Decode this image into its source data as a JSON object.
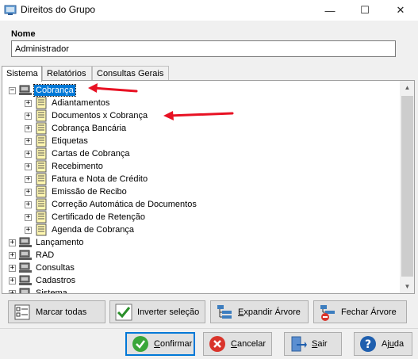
{
  "window": {
    "title": "Direitos do Grupo",
    "controls": {
      "minimize": "—",
      "maximize": "☐",
      "close": "✕"
    }
  },
  "nome": {
    "label": "Nome",
    "value": "Administrador"
  },
  "tabs": [
    {
      "label": "Sistema",
      "active": true
    },
    {
      "label": "Relatórios",
      "active": false
    },
    {
      "label": "Consultas Gerais",
      "active": false
    }
  ],
  "tree": {
    "root_selected": "Cobrança",
    "children_of_cobranca": [
      "Adiantamentos",
      "Documentos x Cobrança",
      "Cobrança Bancária",
      "Etiquetas",
      "Cartas de Cobrança",
      "Recebimento",
      "Fatura e Nota de Crédito",
      "Emissão de Recibo",
      "Correção Automática de Documentos",
      "Certificado de Retenção",
      "Agenda de Cobrança"
    ],
    "other_roots": [
      "Lançamento",
      "RAD",
      "Consultas",
      "Cadastros",
      "Sistema"
    ],
    "expander_collapsed": "+",
    "expander_expanded": "−"
  },
  "actions": {
    "marcar_todas": "Marcar todas",
    "inverter_selecao": "Inverter seleção",
    "expandir_arvore": "Expandir Árvore",
    "fechar_arvore": "Fechar Árvore"
  },
  "dialog_buttons": {
    "confirmar": {
      "mnemonic": "C",
      "rest": "onfirmar"
    },
    "cancelar": {
      "mnemonic": "C",
      "rest": "ancelar"
    },
    "sair": {
      "mnemonic": "S",
      "rest": "air"
    },
    "ajuda": {
      "pre": "Aj",
      "mnemonic": "u",
      "rest": "da"
    }
  },
  "colors": {
    "selection": "#0078d7",
    "annotation_arrow": "#e81123",
    "confirm_green": "#3aa63a",
    "cancel_red": "#d9342b",
    "help_blue": "#1f5fae"
  }
}
